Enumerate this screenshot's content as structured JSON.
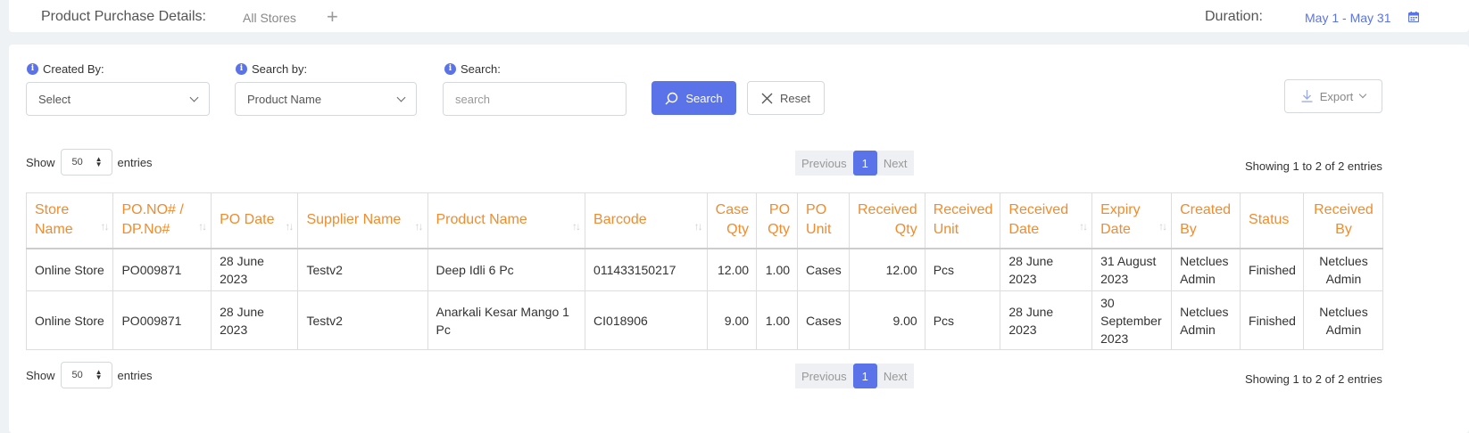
{
  "header": {
    "title": "Product Purchase Details:",
    "stores": "All Stores",
    "add_icon": "plus-icon",
    "duration_label": "Duration:",
    "duration_value": "May 1 - May 31",
    "calendar_icon": "calendar-icon"
  },
  "filters": {
    "created_by_label": "Created By:",
    "created_by_value": "Select",
    "search_by_label": "Search by:",
    "search_by_value": "Product Name",
    "search_label": "Search:",
    "search_placeholder": "search",
    "search_button": "Search",
    "reset_button": "Reset",
    "export_button": "Export"
  },
  "table_controls": {
    "show": "Show",
    "entries": "entries",
    "page_length": "50",
    "previous": "Previous",
    "page": "1",
    "next": "Next",
    "info": "Showing 1 to 2 of 2 entries"
  },
  "table": {
    "columns": [
      "Store Name",
      "PO.NO# / DP.No#",
      "PO Date",
      "Supplier Name",
      "Product Name",
      "Barcode",
      "Case Qty",
      "PO Qty",
      "PO Unit",
      "Received Qty",
      "Received Unit",
      "Received Date",
      "Expiry Date",
      "Created By",
      "Status",
      "Received By"
    ],
    "rows": [
      [
        "Online Store",
        "PO009871",
        "28 June 2023",
        "Testv2",
        "Deep Idli 6 Pc",
        "011433150217",
        "12.00",
        "1.00",
        "Cases",
        "12.00",
        "Pcs",
        "28 June 2023",
        "31 August 2023",
        "Netclues Admin",
        "Finished",
        "Netclues Admin"
      ],
      [
        "Online Store",
        "PO009871",
        "28 June 2023",
        "Testv2",
        "Anarkali Kesar Mango 1 Pc",
        "CI018906",
        "9.00",
        "1.00",
        "Cases",
        "9.00",
        "Pcs",
        "28 June 2023",
        "30 September 2023",
        "Netclues Admin",
        "Finished",
        "Netclues Admin"
      ]
    ]
  },
  "colors": {
    "accent": "#5b73e8",
    "header_text": "#f08c2e"
  }
}
